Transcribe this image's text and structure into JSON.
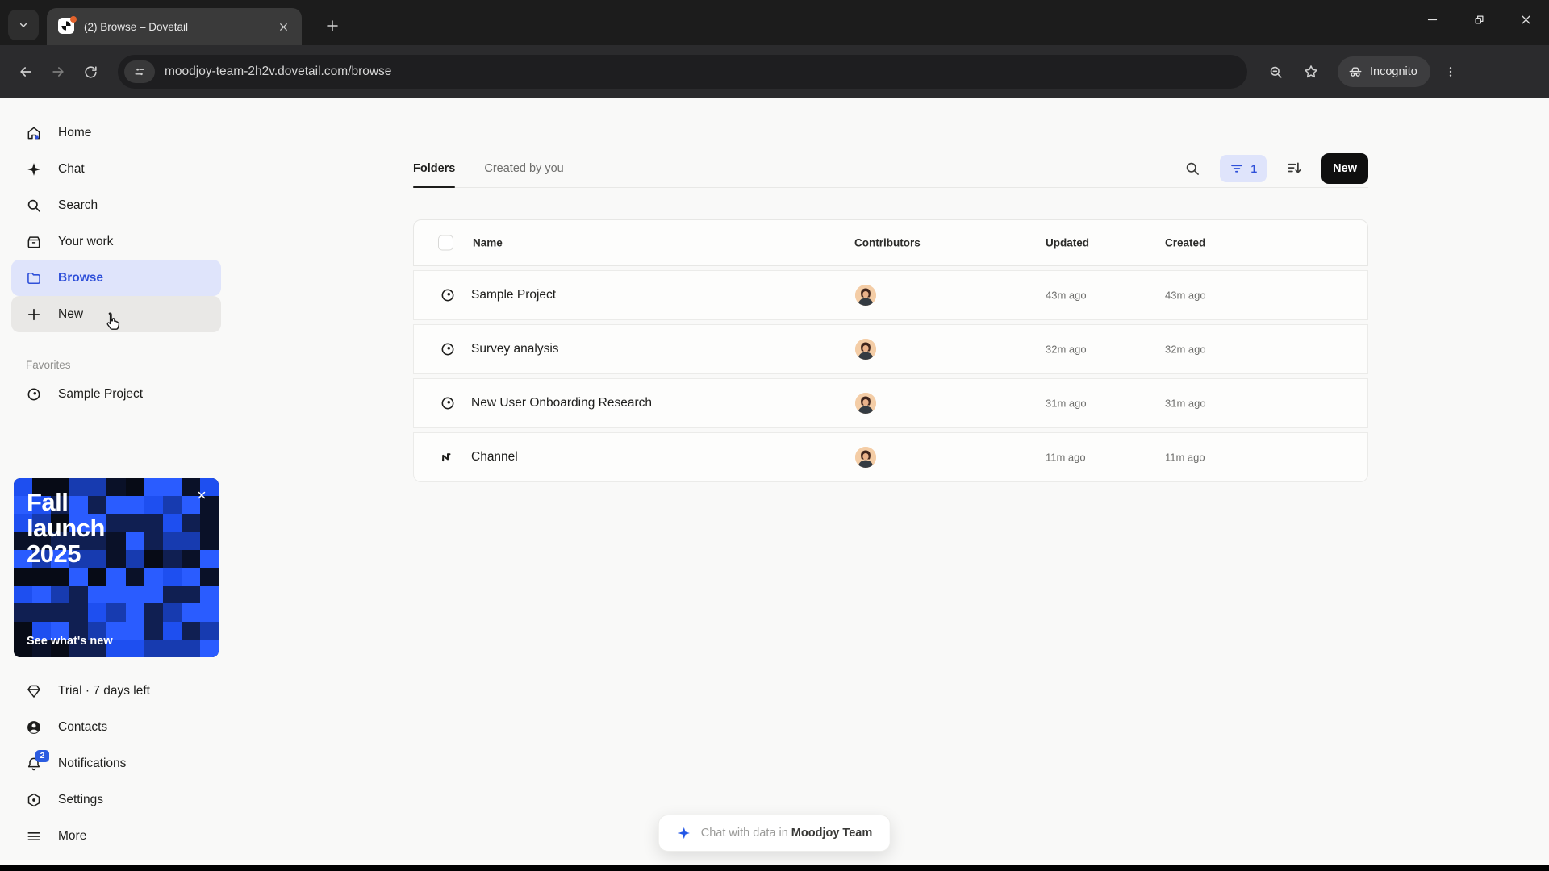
{
  "browser": {
    "tab_title": "(2) Browse – Dovetail",
    "url": "moodjoy-team-2h2v.dovetail.com/browse",
    "incognito_label": "Incognito"
  },
  "sidebar": {
    "items": [
      {
        "label": "Home"
      },
      {
        "label": "Chat"
      },
      {
        "label": "Search"
      },
      {
        "label": "Your work"
      },
      {
        "label": "Browse"
      },
      {
        "label": "New"
      }
    ],
    "favorites_label": "Favorites",
    "favorites": [
      {
        "label": "Sample Project"
      }
    ],
    "promo": {
      "title": "Fall launch 2025",
      "link_label": "See what's new"
    },
    "bottom_items": [
      {
        "label": "Trial · 7 days left"
      },
      {
        "label": "Contacts"
      },
      {
        "label": "Notifications",
        "badge": "2"
      },
      {
        "label": "Settings"
      },
      {
        "label": "More"
      }
    ]
  },
  "main": {
    "tabs": [
      {
        "label": "Folders"
      },
      {
        "label": "Created by you"
      }
    ],
    "controls": {
      "filter_count": "1",
      "new_button_label": "New"
    },
    "table": {
      "columns": [
        "Name",
        "Contributors",
        "Updated",
        "Created"
      ],
      "rows": [
        {
          "name": "Sample Project",
          "icon": "project",
          "updated": "43m ago",
          "created": "43m ago"
        },
        {
          "name": "Survey analysis",
          "icon": "project",
          "updated": "32m ago",
          "created": "32m ago"
        },
        {
          "name": "New User Onboarding Research",
          "icon": "project",
          "updated": "31m ago",
          "created": "31m ago"
        },
        {
          "name": "Channel",
          "icon": "channel",
          "updated": "11m ago",
          "created": "11m ago"
        }
      ]
    }
  },
  "footer": {
    "chat_prefix": "Chat with data in",
    "team_name": "Moodjoy Team"
  },
  "colors": {
    "accent_blue": "#2f50d9",
    "selected_bg": "#dfe4fb",
    "badge_blue": "#2b5ce0",
    "new_button_bg": "#0f0f0f",
    "promo_palette": [
      "#070b16",
      "#0a1128",
      "#101f52",
      "#173bb0",
      "#1e4ff0",
      "#2a5cff"
    ]
  }
}
